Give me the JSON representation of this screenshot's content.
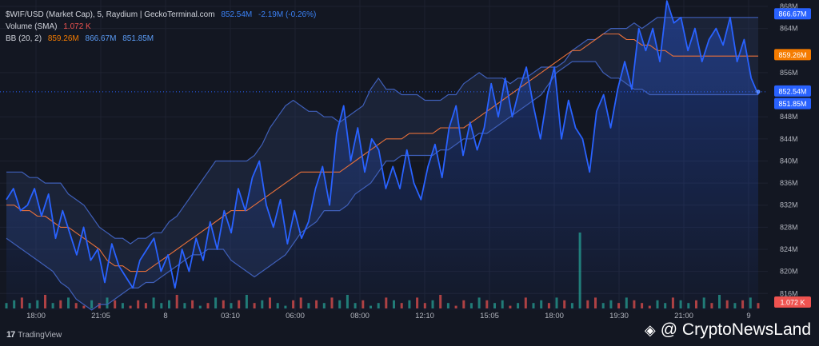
{
  "legend": {
    "title": "$WIF/USD (Market Cap), 5, Raydium | GeckoTerminal.com",
    "price": "852.54M",
    "change": "-2.19M (-0.26%)",
    "volume_label": "Volume (SMA)",
    "volume_value": "1.072 K",
    "bb_label": "BB (20, 2)",
    "bb_basis": "859.26M",
    "bb_upper": "866.67M",
    "bb_lower": "851.85M"
  },
  "branding": {
    "tradingview": "TradingView",
    "watermark": "@ CryptoNewsLand"
  },
  "colors": {
    "background": "#131722",
    "price_line": "#2962ff",
    "bands": "#3f5fb8",
    "basis": "#e8703a",
    "vol_up": "#26a69a",
    "vol_down": "#ef5350",
    "price_tag": "#2962ff",
    "basis_tag": "#f57c00",
    "vol_tag": "#ef5350"
  },
  "chart_data": {
    "type": "line",
    "ylim": [
      813,
      868
    ],
    "y_ticks": [
      {
        "value": 816,
        "label": "816M"
      },
      {
        "value": 820,
        "label": "820M"
      },
      {
        "value": 824,
        "label": "824M"
      },
      {
        "value": 828,
        "label": "828M"
      },
      {
        "value": 832,
        "label": "832M"
      },
      {
        "value": 836,
        "label": "836M"
      },
      {
        "value": 840,
        "label": "840M"
      },
      {
        "value": 844,
        "label": "844M"
      },
      {
        "value": 848,
        "label": "848M"
      },
      {
        "value": 856,
        "label": "856M"
      },
      {
        "value": 864,
        "label": "864M"
      },
      {
        "value": 868,
        "label": "868M"
      }
    ],
    "x_ticks": [
      "18:00",
      "21:05",
      "8",
      "03:10",
      "06:00",
      "08:00",
      "12:10",
      "15:05",
      "18:00",
      "19:30",
      "21:00",
      "9"
    ],
    "price_tags": [
      {
        "label": "866.67M",
        "value": 866.67,
        "kind": "upper"
      },
      {
        "label": "859.26M",
        "value": 859.26,
        "kind": "basis"
      },
      {
        "label": "852.54M",
        "value": 852.54,
        "kind": "price"
      },
      {
        "label": "851.85M",
        "value": 851.85,
        "kind": "lower"
      }
    ],
    "volume_tag": {
      "label": "1.072 K"
    },
    "series": [
      {
        "name": "Market Cap",
        "values": [
          833,
          835,
          831,
          832,
          835,
          830,
          834,
          826,
          831,
          827,
          823,
          828,
          822,
          824,
          818,
          825,
          821,
          819,
          817,
          822,
          824,
          826,
          820,
          823,
          817,
          824,
          820,
          826,
          822,
          829,
          824,
          831,
          827,
          835,
          831,
          837,
          840,
          832,
          828,
          833,
          825,
          831,
          826,
          829,
          835,
          839,
          832,
          845,
          850,
          840,
          846,
          838,
          844,
          842,
          835,
          839,
          835,
          842,
          836,
          833,
          839,
          843,
          837,
          846,
          850,
          841,
          847,
          842,
          846,
          854,
          848,
          855,
          848,
          853,
          857,
          850,
          844,
          852,
          857,
          844,
          851,
          846,
          844,
          838,
          849,
          852,
          846,
          853,
          858,
          853,
          864,
          860,
          864,
          858,
          869,
          865,
          866,
          860,
          864,
          858,
          862,
          864,
          861,
          866,
          858,
          862,
          855,
          852
        ]
      },
      {
        "name": "BB Upper",
        "values": [
          838,
          838,
          838,
          837,
          837,
          836,
          836,
          836,
          834,
          833,
          832,
          830,
          828,
          827,
          826,
          826,
          825,
          826,
          826,
          827,
          827,
          829,
          830,
          832,
          834,
          836,
          838,
          840,
          840,
          840,
          840,
          840,
          841,
          843,
          846,
          848,
          850,
          851,
          850,
          849,
          849,
          848,
          848,
          847,
          848,
          849,
          850,
          853,
          855,
          853,
          853,
          852,
          852,
          852,
          851,
          851,
          851,
          852,
          852,
          854,
          855,
          856,
          855,
          855,
          855,
          854,
          855,
          855,
          856,
          857,
          857,
          857,
          858,
          860,
          861,
          862,
          862,
          863,
          864,
          864,
          864,
          865,
          864,
          865,
          866,
          866,
          866,
          866,
          866,
          866,
          866,
          866,
          866,
          866,
          866,
          866,
          866,
          866
        ]
      },
      {
        "name": "BB Basis",
        "values": [
          832,
          832,
          831,
          831,
          830,
          830,
          829,
          828,
          828,
          827,
          826,
          825,
          824,
          822,
          821,
          821,
          820,
          820,
          820,
          821,
          822,
          823,
          824,
          825,
          826,
          827,
          828,
          829,
          830,
          831,
          831,
          831,
          832,
          833,
          834,
          835,
          836,
          837,
          838,
          838,
          838,
          838,
          838,
          838,
          839,
          840,
          841,
          842,
          843,
          844,
          844,
          844,
          845,
          845,
          845,
          845,
          846,
          846,
          846,
          846,
          847,
          848,
          849,
          850,
          851,
          852,
          853,
          854,
          855,
          856,
          857,
          858,
          859,
          860,
          860,
          861,
          862,
          863,
          863,
          863,
          862,
          862,
          861,
          861,
          860,
          860,
          859,
          859,
          859,
          859,
          859,
          859,
          859,
          859,
          859,
          859,
          859,
          859
        ]
      },
      {
        "name": "BB Lower",
        "values": [
          826,
          825,
          824,
          823,
          822,
          821,
          820,
          818,
          817,
          815,
          814,
          813,
          814,
          814,
          815,
          816,
          817,
          817,
          818,
          818,
          819,
          820,
          821,
          822,
          823,
          823,
          824,
          824,
          824,
          822,
          821,
          820,
          819,
          820,
          821,
          822,
          823,
          825,
          827,
          828,
          829,
          831,
          831,
          831,
          832,
          834,
          835,
          836,
          838,
          840,
          840,
          841,
          841,
          841,
          841,
          841,
          842,
          842,
          843,
          844,
          844,
          845,
          845,
          846,
          847,
          848,
          849,
          850,
          851,
          852,
          854,
          856,
          857,
          858,
          858,
          858,
          858,
          856,
          855,
          855,
          854,
          853,
          853,
          852,
          852,
          852,
          852,
          852,
          852,
          852,
          852,
          852,
          852,
          852,
          852,
          852,
          852,
          852
        ]
      },
      {
        "name": "Volume",
        "values": [
          2,
          3,
          4,
          2,
          3,
          5,
          2,
          3,
          4,
          2,
          1,
          3,
          2,
          4,
          3,
          2,
          1,
          3,
          2,
          4,
          2,
          3,
          5,
          2,
          3,
          1,
          2,
          4,
          3,
          2,
          3,
          5,
          2,
          3,
          4,
          2,
          1,
          3,
          4,
          2,
          3,
          2,
          4,
          3,
          5,
          2,
          3,
          1,
          2,
          4,
          3,
          2,
          3,
          4,
          2,
          3,
          5,
          2,
          1,
          3,
          2,
          4,
          3,
          2,
          3,
          1,
          2,
          4,
          2,
          3,
          2,
          4,
          3,
          2,
          28,
          3,
          4,
          2,
          3,
          2,
          4,
          3,
          2,
          1,
          3,
          2,
          4,
          3,
          2,
          3,
          4,
          2,
          5,
          3,
          2,
          3,
          4,
          2
        ]
      }
    ]
  }
}
